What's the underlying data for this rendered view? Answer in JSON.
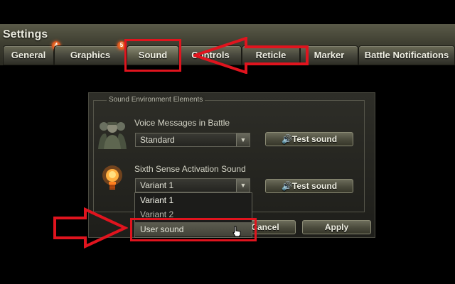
{
  "window": {
    "title": "Settings"
  },
  "tabs": [
    {
      "label": "General",
      "badge": "4"
    },
    {
      "label": "Graphics",
      "badge": "5"
    },
    {
      "label": "Sound",
      "active": true
    },
    {
      "label": "Controls"
    },
    {
      "label": "Reticle"
    },
    {
      "label": "Marker"
    },
    {
      "label": "Battle Notifications"
    }
  ],
  "sound_panel": {
    "section_title": "Sound Environment Elements",
    "voice_messages": {
      "label": "Voice Messages in Battle",
      "value": "Standard",
      "icon": "soldiers-icon",
      "test_button": "Test sound"
    },
    "sixth_sense": {
      "label": "Sixth Sense Activation Sound",
      "value": "Variant 1",
      "icon": "light-bulb-icon",
      "test_button": "Test sound",
      "options": [
        "Variant 1",
        "Variant 2",
        "User sound"
      ],
      "hovered_option": "User sound"
    },
    "footer": {
      "cancel_label": "Cancel",
      "apply_label": "Apply"
    }
  },
  "annotations": {
    "highlight_color": "#e0141e"
  },
  "colors": {
    "badge": "#e05018",
    "panel": "#25251f",
    "tab": "#4a4a3c"
  }
}
